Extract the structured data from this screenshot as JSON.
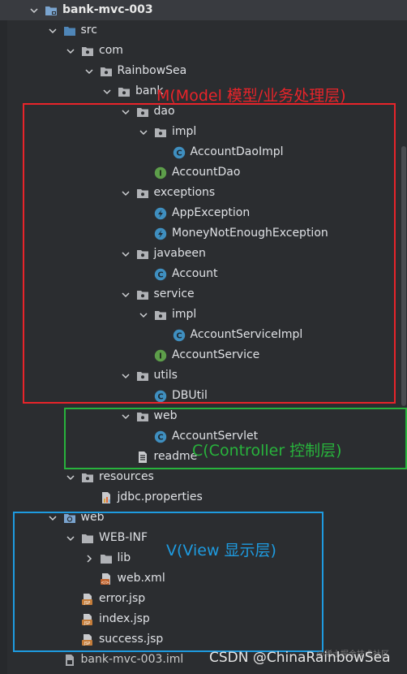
{
  "tree": [
    {
      "label": "bank-mvc-003",
      "icon": "module-folder-icon",
      "expand": "open",
      "depth": 0,
      "bold": true,
      "selected": true
    },
    {
      "label": "src",
      "icon": "source-folder-icon",
      "expand": "open",
      "depth": 1
    },
    {
      "label": "com",
      "icon": "package-icon",
      "expand": "open",
      "depth": 2
    },
    {
      "label": "RainbowSea",
      "icon": "package-icon",
      "expand": "open",
      "depth": 3
    },
    {
      "label": "bank",
      "icon": "package-icon",
      "expand": "open",
      "depth": 4
    },
    {
      "label": "dao",
      "icon": "package-icon",
      "expand": "open",
      "depth": 5
    },
    {
      "label": "impl",
      "icon": "package-icon",
      "expand": "open",
      "depth": 6
    },
    {
      "label": "AccountDaoImpl",
      "icon": "class-icon",
      "expand": "none",
      "depth": 7
    },
    {
      "label": "AccountDao",
      "icon": "interface-icon",
      "expand": "none",
      "depth": 6
    },
    {
      "label": "exceptions",
      "icon": "package-icon",
      "expand": "open",
      "depth": 5
    },
    {
      "label": "AppException",
      "icon": "exception-class-icon",
      "expand": "none",
      "depth": 6
    },
    {
      "label": "MoneyNotEnoughException",
      "icon": "exception-class-icon",
      "expand": "none",
      "depth": 6
    },
    {
      "label": "javabeen",
      "icon": "package-icon",
      "expand": "open",
      "depth": 5
    },
    {
      "label": "Account",
      "icon": "class-icon",
      "expand": "none",
      "depth": 6
    },
    {
      "label": "service",
      "icon": "package-icon",
      "expand": "open",
      "depth": 5
    },
    {
      "label": "impl",
      "icon": "package-icon",
      "expand": "open",
      "depth": 6
    },
    {
      "label": "AccountServiceImpl",
      "icon": "class-icon",
      "expand": "none",
      "depth": 7
    },
    {
      "label": "AccountService",
      "icon": "interface-icon",
      "expand": "none",
      "depth": 6
    },
    {
      "label": "utils",
      "icon": "package-icon",
      "expand": "open",
      "depth": 5
    },
    {
      "label": "DBUtil",
      "icon": "class-icon",
      "expand": "none",
      "depth": 6
    },
    {
      "label": "web",
      "icon": "package-icon",
      "expand": "open",
      "depth": 5
    },
    {
      "label": "AccountServlet",
      "icon": "class-icon",
      "expand": "none",
      "depth": 6
    },
    {
      "label": "readme",
      "icon": "text-file-icon",
      "expand": "none",
      "depth": 5
    },
    {
      "label": "resources",
      "icon": "package-icon",
      "expand": "open",
      "depth": 2
    },
    {
      "label": "jdbc.properties",
      "icon": "properties-file-icon",
      "expand": "none",
      "depth": 3
    },
    {
      "label": "web",
      "icon": "web-folder-icon",
      "expand": "open",
      "depth": 1
    },
    {
      "label": "WEB-INF",
      "icon": "folder-icon",
      "expand": "open",
      "depth": 2
    },
    {
      "label": "lib",
      "icon": "folder-icon",
      "expand": "closed",
      "depth": 3
    },
    {
      "label": "web.xml",
      "icon": "xml-file-icon",
      "expand": "none",
      "depth": 3
    },
    {
      "label": "error.jsp",
      "icon": "jsp-file-icon",
      "expand": "none",
      "depth": 2
    },
    {
      "label": "index.jsp",
      "icon": "jsp-file-icon",
      "expand": "none",
      "depth": 2
    },
    {
      "label": "success.jsp",
      "icon": "jsp-file-icon",
      "expand": "none",
      "depth": 2
    },
    {
      "label": "bank-mvc-003.iml",
      "icon": "iml-file-icon",
      "expand": "none",
      "depth": 1,
      "muted": true
    }
  ],
  "annotations": {
    "model": {
      "text": "M(Model 模型/业务处理层)",
      "color": "#e8242a"
    },
    "controller": {
      "text": "C(Controller 控制层)",
      "color": "#28b33c"
    },
    "view": {
      "text": "V(View 显示层)",
      "color": "#1e9be0"
    }
  },
  "watermark": {
    "text": "CSDN @ChinaRainbowSea",
    "faint": "@稀土掘金技术社区"
  }
}
